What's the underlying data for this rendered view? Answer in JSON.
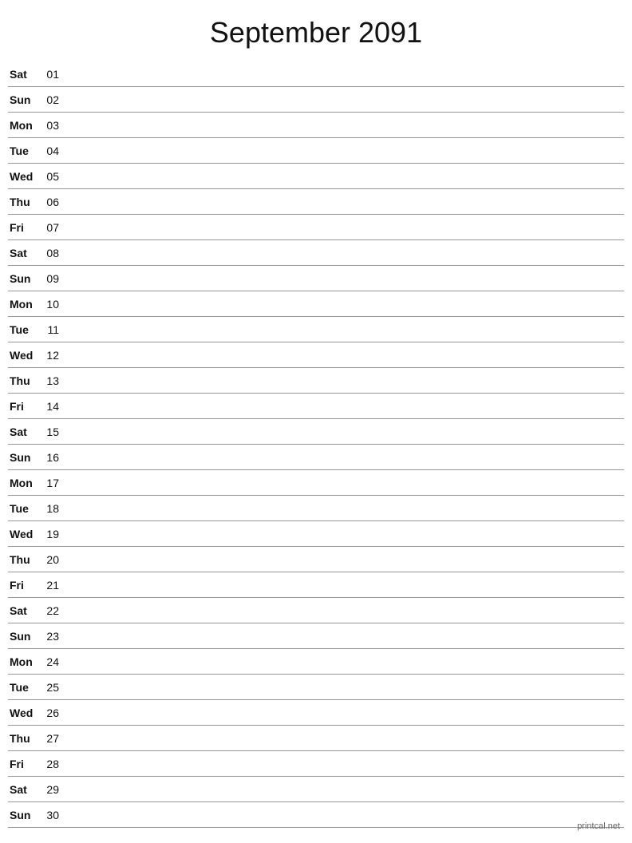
{
  "page": {
    "title": "September 2091"
  },
  "footer": {
    "text": "printcal.net"
  },
  "days": [
    {
      "name": "Sat",
      "number": "01"
    },
    {
      "name": "Sun",
      "number": "02"
    },
    {
      "name": "Mon",
      "number": "03"
    },
    {
      "name": "Tue",
      "number": "04"
    },
    {
      "name": "Wed",
      "number": "05"
    },
    {
      "name": "Thu",
      "number": "06"
    },
    {
      "name": "Fri",
      "number": "07"
    },
    {
      "name": "Sat",
      "number": "08"
    },
    {
      "name": "Sun",
      "number": "09"
    },
    {
      "name": "Mon",
      "number": "10"
    },
    {
      "name": "Tue",
      "number": "11"
    },
    {
      "name": "Wed",
      "number": "12"
    },
    {
      "name": "Thu",
      "number": "13"
    },
    {
      "name": "Fri",
      "number": "14"
    },
    {
      "name": "Sat",
      "number": "15"
    },
    {
      "name": "Sun",
      "number": "16"
    },
    {
      "name": "Mon",
      "number": "17"
    },
    {
      "name": "Tue",
      "number": "18"
    },
    {
      "name": "Wed",
      "number": "19"
    },
    {
      "name": "Thu",
      "number": "20"
    },
    {
      "name": "Fri",
      "number": "21"
    },
    {
      "name": "Sat",
      "number": "22"
    },
    {
      "name": "Sun",
      "number": "23"
    },
    {
      "name": "Mon",
      "number": "24"
    },
    {
      "name": "Tue",
      "number": "25"
    },
    {
      "name": "Wed",
      "number": "26"
    },
    {
      "name": "Thu",
      "number": "27"
    },
    {
      "name": "Fri",
      "number": "28"
    },
    {
      "name": "Sat",
      "number": "29"
    },
    {
      "name": "Sun",
      "number": "30"
    }
  ]
}
